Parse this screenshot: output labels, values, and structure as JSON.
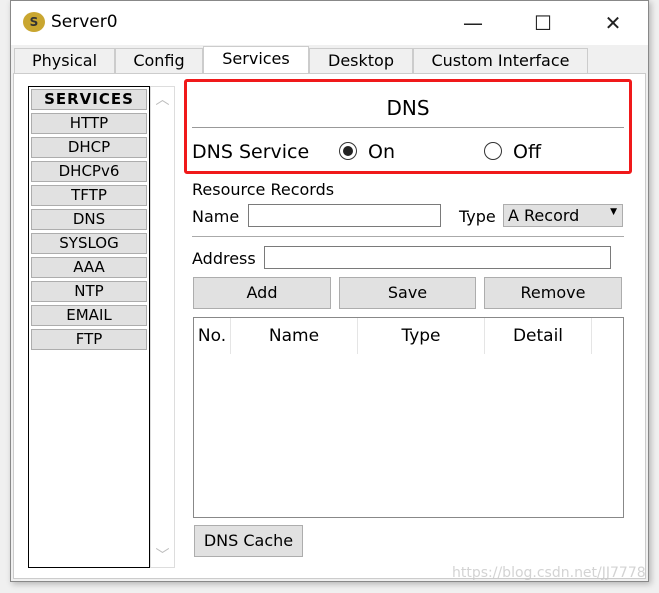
{
  "window": {
    "title": "Server0",
    "minimize": "—",
    "maximize": "☐",
    "close": "✕"
  },
  "tabs": [
    "Physical",
    "Config",
    "Services",
    "Desktop",
    "Custom Interface"
  ],
  "active_tab": "Services",
  "sidebar": {
    "header": "SERVICES",
    "items": [
      "HTTP",
      "DHCP",
      "DHCPv6",
      "TFTP",
      "DNS",
      "SYSLOG",
      "AAA",
      "NTP",
      "EMAIL",
      "FTP"
    ]
  },
  "dns": {
    "heading": "DNS",
    "service_label": "DNS Service",
    "on_label": "On",
    "off_label": "Off",
    "selected": "On",
    "resource_records": "Resource Records",
    "name_label": "Name",
    "name_value": "",
    "type_label": "Type",
    "type_value": "A Record",
    "address_label": "Address",
    "address_value": "",
    "add": "Add",
    "save": "Save",
    "remove": "Remove",
    "columns": [
      "No.",
      "Name",
      "Type",
      "Detail"
    ],
    "rows": [],
    "cache": "DNS Cache"
  },
  "highlight_color": "#f0191a",
  "watermark": "https://blog.csdn.net/JJ7778"
}
